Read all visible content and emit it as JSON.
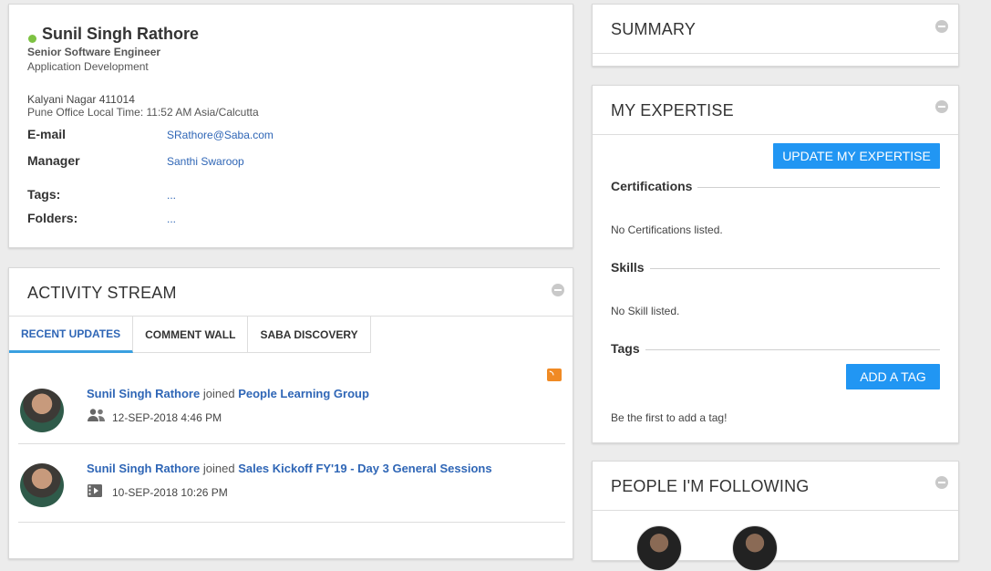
{
  "profile": {
    "name": "Sunil Singh Rathore",
    "title": "Senior Software Engineer",
    "department": "Application Development",
    "address": "Kalyani Nagar 411014",
    "local_time": "Pune Office Local Time: 11:52 AM Asia/Calcutta",
    "email_label": "E-mail",
    "email": "SRathore@Saba.com",
    "manager_label": "Manager",
    "manager": "Santhi Swaroop",
    "tags_label": "Tags:",
    "tags_value": "...",
    "folders_label": "Folders:",
    "folders_value": "...",
    "status_color": "#7dc242"
  },
  "activity": {
    "title": "ACTIVITY STREAM",
    "tabs": [
      {
        "label": "RECENT UPDATES",
        "active": true
      },
      {
        "label": "COMMENT WALL",
        "active": false
      },
      {
        "label": "SABA DISCOVERY",
        "active": false
      }
    ],
    "items": [
      {
        "user": "Sunil Singh Rathore",
        "verb": "joined",
        "target": "People Learning Group",
        "icon": "group-icon",
        "date": "12-SEP-2018 4:46 PM"
      },
      {
        "user": "Sunil Singh Rathore",
        "verb": "joined",
        "target": "Sales Kickoff FY'19 - Day 3 General Sessions",
        "icon": "video-icon",
        "date": "10-SEP-2018 10:26 PM"
      }
    ]
  },
  "summary": {
    "title": "SUMMARY"
  },
  "expertise": {
    "title": "MY EXPERTISE",
    "update_button": "UPDATE MY EXPERTISE",
    "certifications_heading": "Certifications",
    "certifications_empty": "No Certifications listed.",
    "skills_heading": "Skills",
    "skills_empty": "No Skill listed.",
    "tags_heading": "Tags",
    "add_tag_button": "ADD A TAG",
    "tags_empty": "Be the first to add a tag!",
    "accent_color": "#2196f3"
  },
  "following": {
    "title": "PEOPLE I'M FOLLOWING"
  }
}
